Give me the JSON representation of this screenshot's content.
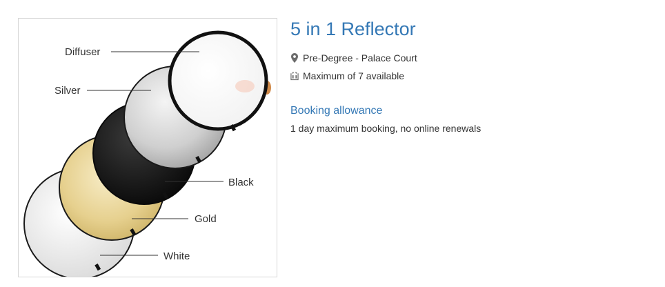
{
  "product": {
    "title": "5 in 1 Reflector",
    "location": "Pre-Degree - Palace Court",
    "availability": "Maximum of 7 available",
    "location_icon": "map-marker-icon",
    "availability_icon": "stock-units-icon"
  },
  "booking": {
    "heading": "Booking allowance",
    "text": "1 day maximum booking, no online renewals"
  },
  "image": {
    "labels": {
      "diffuser": "Diffuser",
      "silver": "Silver",
      "black": "Black",
      "gold": "Gold",
      "white": "White"
    }
  },
  "colors": {
    "title": "#3478b5",
    "text": "#333333",
    "frame_border": "#d6d6d6"
  }
}
